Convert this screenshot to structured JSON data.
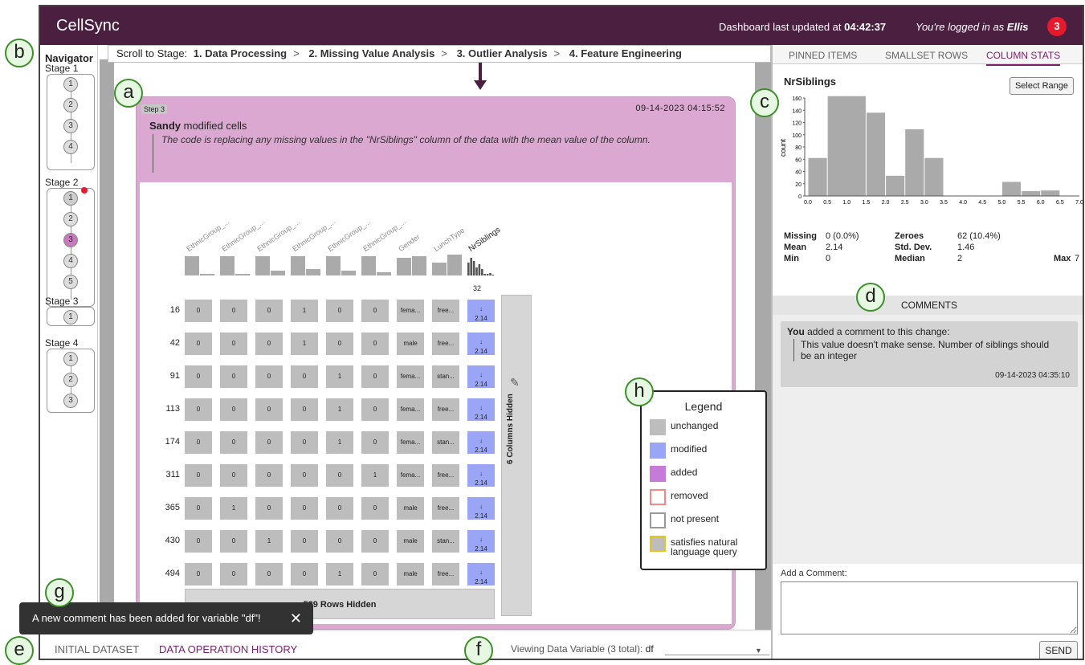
{
  "app": {
    "title": "CellSync",
    "updated_prefix": "Dashboard last updated at ",
    "updated_time": "04:42:37",
    "login_prefix": "You're logged in as ",
    "user": "Ellis",
    "notifications": "3"
  },
  "navigator": {
    "title": "Navigator",
    "stages": [
      {
        "label": "Stage 1",
        "steps": [
          "1",
          "2",
          "3",
          "4"
        ]
      },
      {
        "label": "Stage 2",
        "steps": [
          "1",
          "2",
          "3",
          "4",
          "5"
        ]
      },
      {
        "label": "Stage 3",
        "steps": [
          "1"
        ]
      },
      {
        "label": "Stage 4",
        "steps": [
          "1",
          "2",
          "3"
        ]
      }
    ]
  },
  "stagebar": {
    "label": "Scroll to Stage:",
    "stages": [
      "1. Data Processing",
      "2. Missing Value Analysis",
      "3. Outlier Analysis",
      "4. Feature Engineering"
    ],
    "sep": ">"
  },
  "card": {
    "step": "Step 3",
    "time": "09-14-2023 04:15:52",
    "actor": "Sandy",
    "action": " modified cells",
    "description": "The code is replacing any missing values in the \"NrSiblings\" column of the data with the mean value of the column."
  },
  "table": {
    "columns": [
      "EthnicGroup_...",
      "EthnicGroup_...",
      "EthnicGroup_...",
      "EthnicGroup_...",
      "EthnicGroup_...",
      "EthnicGroup_...",
      "Gender",
      "LunchType",
      "NrSiblings"
    ],
    "rows": [
      {
        "id": "16",
        "cells": [
          "0",
          "0",
          "0",
          "1",
          "0",
          "0",
          "fema...",
          "free...",
          "2.14"
        ]
      },
      {
        "id": "42",
        "cells": [
          "0",
          "0",
          "0",
          "1",
          "0",
          "0",
          "male",
          "free...",
          "2.14"
        ]
      },
      {
        "id": "91",
        "cells": [
          "0",
          "0",
          "0",
          "0",
          "1",
          "0",
          "fema...",
          "stan...",
          "2.14"
        ]
      },
      {
        "id": "113",
        "cells": [
          "0",
          "0",
          "0",
          "0",
          "1",
          "0",
          "fema...",
          "free...",
          "2.14"
        ]
      },
      {
        "id": "174",
        "cells": [
          "0",
          "0",
          "0",
          "0",
          "1",
          "0",
          "fema...",
          "stan...",
          "2.14"
        ]
      },
      {
        "id": "311",
        "cells": [
          "0",
          "0",
          "0",
          "0",
          "0",
          "1",
          "fema...",
          "free...",
          "2.14"
        ]
      },
      {
        "id": "365",
        "cells": [
          "0",
          "1",
          "0",
          "0",
          "0",
          "0",
          "male",
          "free...",
          "2.14"
        ]
      },
      {
        "id": "430",
        "cells": [
          "0",
          "0",
          "1",
          "0",
          "0",
          "0",
          "male",
          "stan...",
          "2.14"
        ]
      },
      {
        "id": "494",
        "cells": [
          "0",
          "0",
          "0",
          "0",
          "1",
          "0",
          "male",
          "free...",
          "2.14"
        ]
      }
    ],
    "modified_count": "32",
    "columns_hidden": "6 Columns Hidden",
    "rows_hidden": "589 Rows Hidden"
  },
  "legend": {
    "title": "Legend",
    "items": [
      {
        "label": "unchanged",
        "color": "#bdbdbd",
        "border": "#bdbdbd"
      },
      {
        "label": "modified",
        "color": "#9aa6f5",
        "border": "#9aa6f5"
      },
      {
        "label": "added",
        "color": "#c77bd9",
        "border": "#c77bd9"
      },
      {
        "label": "removed",
        "color": "#ffffff",
        "border": "#f08a8a"
      },
      {
        "label": "not present",
        "color": "#ffffff",
        "border": "#999999"
      },
      {
        "label": "satisfies natural language query",
        "color": "#bdbdbd",
        "border": "#e6c619"
      }
    ]
  },
  "controls": {
    "info": "ⓘ",
    "zoom_in": "+",
    "zoom_out": "-"
  },
  "bottombar": {
    "tabs": [
      "INITIAL DATASET",
      "DATA OPERATION HISTORY"
    ],
    "viewing_label": "Viewing Data Variable (3 total): ",
    "viewing_value": "df"
  },
  "toast": {
    "text": "A new comment has been added for variable \"df\"!",
    "close": "✕"
  },
  "rightpanel": {
    "tabs": [
      "PINNED ITEMS",
      "SMALLSET ROWS",
      "COLUMN STATS"
    ],
    "variable": "NrSiblings",
    "select_range": "Select Range",
    "stats": {
      "missing_label": "Missing",
      "missing": "0 (0.0%)",
      "zeroes_label": "Zeroes",
      "zeroes": "62 (10.4%)",
      "mean_label": "Mean",
      "mean": "2.14",
      "std_label": "Std. Dev.",
      "std": "1.46",
      "min_label": "Min",
      "min": "0",
      "median_label": "Median",
      "median": "2",
      "max_label": "Max",
      "max": "7"
    },
    "comments_title": "COMMENTS",
    "comment": {
      "author": "You",
      "action": " added a comment to this change:",
      "text": "This value doesn't make sense. Number of siblings should be an integer",
      "time": "09-14-2023 04:35:10"
    },
    "add_label": "Add a Comment:",
    "send": "SEND"
  },
  "chart_data": {
    "type": "bar",
    "title": "NrSiblings",
    "xlabel": "",
    "ylabel": "count",
    "x_ticks": [
      "0.0",
      "0.5",
      "1.0",
      "1.5",
      "2.0",
      "2.5",
      "3.0",
      "3.5",
      "4.0",
      "4.5",
      "5.0",
      "5.5",
      "6.0",
      "6.5",
      "7.0"
    ],
    "y_ticks": [
      "0",
      "20",
      "40",
      "60",
      "80",
      "100",
      "120",
      "140",
      "160"
    ],
    "bins": [
      [
        0,
        0.5
      ],
      [
        0.5,
        1.5
      ],
      [
        1.5,
        2.0
      ],
      [
        2.0,
        2.5
      ],
      [
        2.5,
        3.0
      ],
      [
        3.0,
        3.5
      ],
      [
        3.5,
        4.5
      ],
      [
        5.0,
        5.5
      ],
      [
        5.5,
        6.0
      ],
      [
        6.0,
        6.5
      ]
    ],
    "values": [
      62,
      163,
      136,
      33,
      109,
      62,
      0,
      23,
      8,
      9
    ],
    "xlim": [
      0,
      7
    ],
    "ylim": [
      0,
      160
    ]
  },
  "badges": [
    "a",
    "b",
    "c",
    "d",
    "e",
    "f",
    "g",
    "h"
  ],
  "colors": {
    "brand": "#4b1f3f",
    "accent": "#7a1f6e",
    "card": "#dba8d1",
    "modified": "#9aa6f5",
    "alert": "#e8192c"
  }
}
